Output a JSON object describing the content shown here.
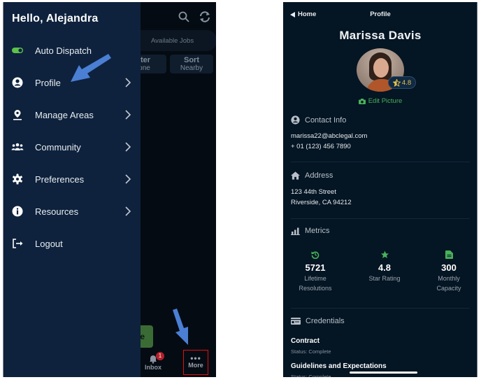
{
  "left_screen": {
    "drawer": {
      "greeting": "Hello, Alejandra",
      "items": [
        {
          "label": "Auto Dispatch",
          "icon": "toggle-icon",
          "toggle_on": true,
          "has_chevron": false
        },
        {
          "label": "Profile",
          "icon": "user-circle-icon",
          "has_chevron": true
        },
        {
          "label": "Manage Areas",
          "icon": "map-pin-icon",
          "has_chevron": true
        },
        {
          "label": "Community",
          "icon": "users-icon",
          "has_chevron": true
        },
        {
          "label": "Preferences",
          "icon": "gear-icon",
          "has_chevron": true
        },
        {
          "label": "Resources",
          "icon": "info-icon",
          "has_chevron": true
        },
        {
          "label": "Logout",
          "icon": "logout-icon",
          "has_chevron": false
        }
      ]
    },
    "background": {
      "jobs_pill": "Available Jobs",
      "filter_button": {
        "line1": "lter",
        "line2": "one"
      },
      "sort_button": {
        "line1": "Sort",
        "line2": "Nearby"
      },
      "green_button_fragment": "e",
      "tabs": [
        {
          "label": "Inbox",
          "badge": "1"
        },
        {
          "label": "More",
          "icon": "more-dots",
          "highlighted": true
        }
      ]
    },
    "annotation_color": "#4a7fd4",
    "highlight_color": "#e01010"
  },
  "right_screen": {
    "nav": {
      "back_label": "Home",
      "title": "Profile"
    },
    "name": "Marissa Davis",
    "rating_badge": "4.8",
    "edit_picture": "Edit Picture",
    "contact": {
      "heading": "Contact Info",
      "email": "marissa22@abclegal.com",
      "phone": "+ 01 (123) 456 7890"
    },
    "address": {
      "heading": "Address",
      "line1": "123 44th Street",
      "line2": "Riverside, CA 94212"
    },
    "metrics": {
      "heading": "Metrics",
      "items": [
        {
          "value": "5721",
          "label1": "Lifetime",
          "label2": "Resolutions",
          "icon": "history-icon"
        },
        {
          "value": "4.8",
          "label1": "Star Rating",
          "label2": "",
          "icon": "star-icon"
        },
        {
          "value": "300",
          "label1": "Monthly",
          "label2": "Capacity",
          "icon": "document-icon"
        }
      ]
    },
    "credentials": {
      "heading": "Credentials",
      "items": [
        {
          "title": "Contract",
          "status": "Status: Complete"
        },
        {
          "title": "Guidelines and Expectations",
          "status": "Status: Complete"
        }
      ]
    },
    "accent_green": "#49b15a",
    "star_gold": "#e8c24a"
  }
}
